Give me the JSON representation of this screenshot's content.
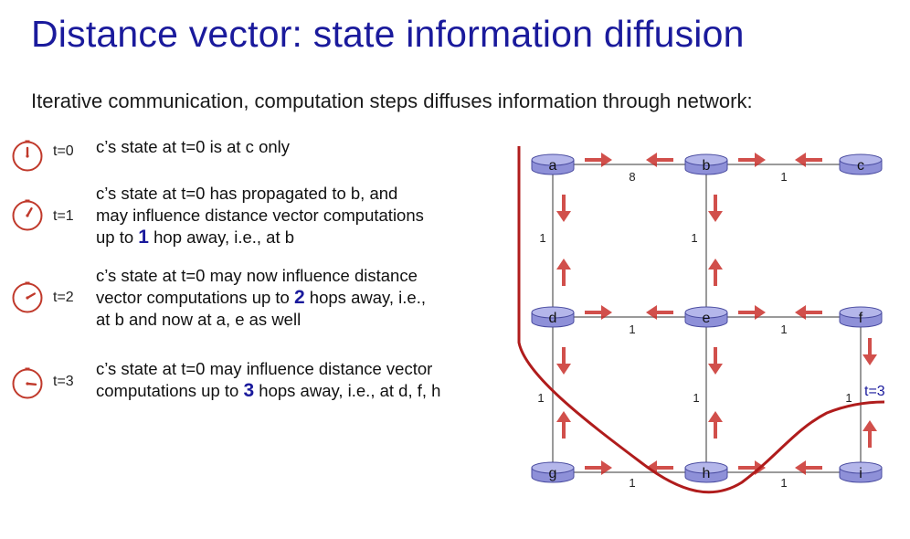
{
  "slide": {
    "title": "Distance vector: state information diffusion",
    "subtitle": "Iterative communication, computation steps diffuses information through network:"
  },
  "steps": [
    {
      "time_label": "t=0",
      "lines": [
        {
          "pre": "c’s state at t=0 is at c only"
        }
      ]
    },
    {
      "time_label": "t=1",
      "lines": [
        {
          "pre": "c’s state at t=0 has propagated to b, and"
        },
        {
          "pre": "may influence distance vector computations"
        },
        {
          "pre": "up to ",
          "hop": "1",
          "post": " hop away, i.e., at b"
        }
      ]
    },
    {
      "time_label": "t=2",
      "lines": [
        {
          "pre": "c’s state at t=0 may now influence distance"
        },
        {
          "pre": "vector computations up to ",
          "hop": "2",
          "post": " hops away, i.e.,"
        },
        {
          "pre": "at b and now at a, e as well"
        }
      ]
    },
    {
      "time_label": "t=3",
      "lines": [
        {
          "pre": "c’s state at t=0 may influence distance vector"
        },
        {
          "pre": "computations up to ",
          "hop": "3",
          "post": " hops away, i.e., at d, f, h"
        }
      ]
    }
  ],
  "network": {
    "nodes": [
      "a",
      "b",
      "c",
      "d",
      "e",
      "f",
      "g",
      "h",
      "i"
    ],
    "link_costs": {
      "a-b": "8",
      "b-c": "1",
      "a-d": "1",
      "b-e": "1",
      "d-e": "1",
      "e-f": "1",
      "d-g": "1",
      "e-h": "1",
      "f-i": "1",
      "g-h": "1",
      "h-i": "1"
    },
    "wavefront_label": "t=3"
  },
  "colors": {
    "title": "#1a1a9c",
    "clock": "#c0392b",
    "arrow": "#c9302c",
    "wavefront": "#b01c1c",
    "router_fill": "#b4b6ea",
    "router_stroke": "#4a4ca0"
  }
}
